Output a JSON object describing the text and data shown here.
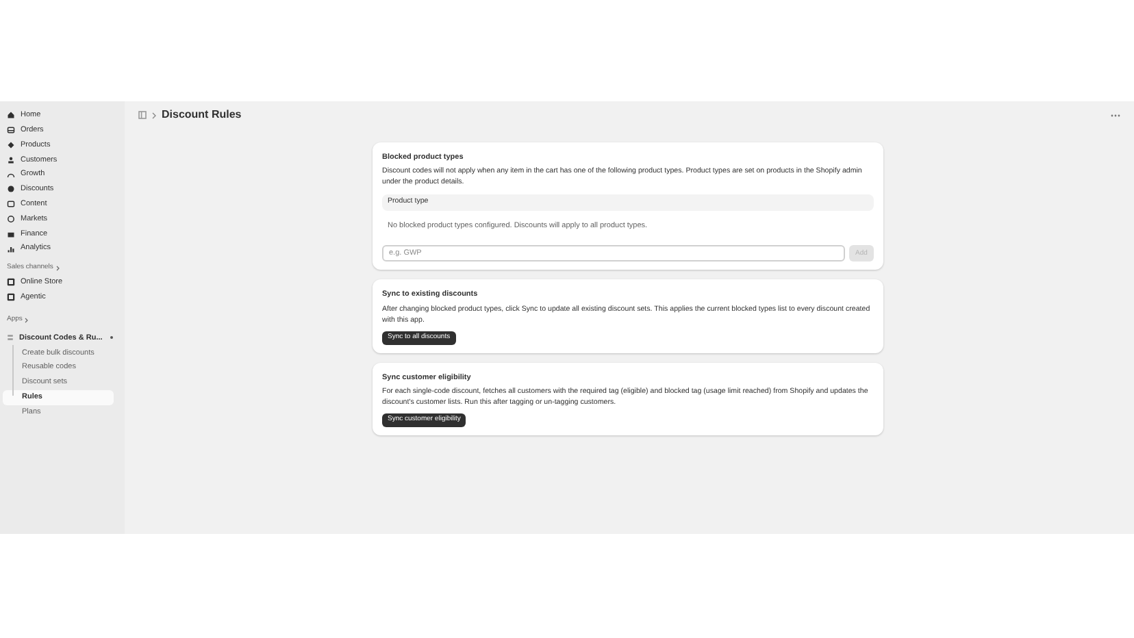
{
  "sidebar": {
    "nav_items": [
      {
        "label": "Home"
      },
      {
        "label": "Orders"
      },
      {
        "label": "Products"
      },
      {
        "label": "Customers"
      },
      {
        "label": "Growth"
      },
      {
        "label": "Discounts"
      },
      {
        "label": "Content"
      },
      {
        "label": "Markets"
      },
      {
        "label": "Finance"
      },
      {
        "label": "Analytics"
      }
    ],
    "sales_channels": {
      "heading": "Sales channels",
      "items": [
        {
          "label": "Online Store"
        },
        {
          "label": "Agentic"
        }
      ]
    },
    "apps": {
      "heading": "Apps",
      "app": {
        "label": "Discount Codes & Ru...",
        "expanded": true,
        "children": [
          {
            "label": "Create bulk discounts",
            "selected": false
          },
          {
            "label": "Reusable codes",
            "selected": false
          },
          {
            "label": "Discount sets",
            "selected": false
          },
          {
            "label": "Rules",
            "selected": true
          },
          {
            "label": "Plans",
            "selected": false
          }
        ]
      }
    }
  },
  "page": {
    "title": "Discount Rules"
  },
  "cards": [
    {
      "kind": "blocked",
      "title": "Blocked product types",
      "description": "Discount codes will not apply when any item in the cart has one of the following product types. Product types are set on products in the Shopify admin under the product details.",
      "table_header": "Product type",
      "empty_message": "No blocked product types configured. Discounts will apply to all product types.",
      "input": {
        "placeholder": "e.g. GWP"
      },
      "button": {
        "label": "Add",
        "disabled": true
      }
    },
    {
      "kind": "action",
      "title": "Sync to existing discounts",
      "description": "After changing blocked product types, click Sync to update all existing discount sets. This applies the current blocked types list to every discount created with this app.",
      "button": {
        "label": "Sync to all discounts",
        "disabled": false
      }
    },
    {
      "kind": "action",
      "title": "Sync customer eligibility",
      "description": "For each single-code discount, fetches all customers with the required tag (eligible) and blocked tag (usage limit reached) from Shopify and updates the discount's customer lists. Run this after tagging or un-tagging customers.",
      "button": {
        "label": "Sync customer eligibility",
        "disabled": false
      }
    }
  ]
}
